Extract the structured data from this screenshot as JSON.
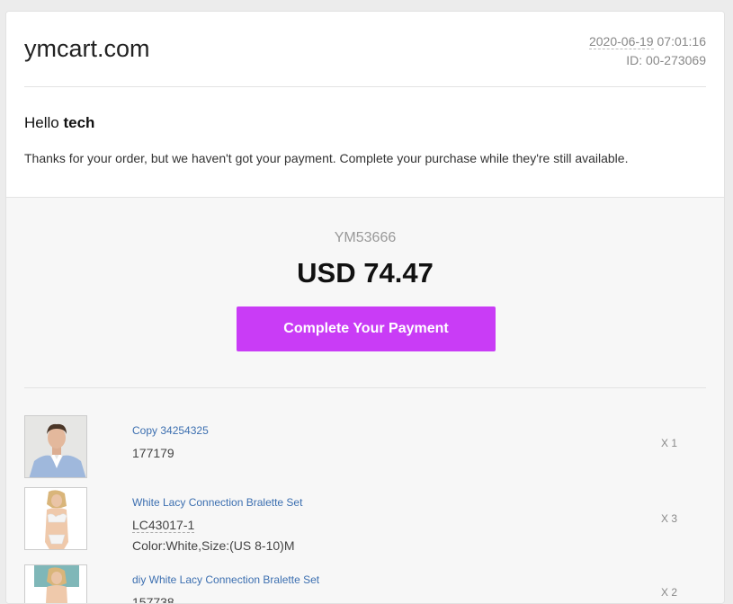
{
  "brand": "ymcart.com",
  "meta": {
    "date": "2020-06-19",
    "time": " 07:01:16",
    "id": "ID: 00-273069"
  },
  "greeting": {
    "hello": "Hello ",
    "name": "tech"
  },
  "message": "Thanks for your order, but we haven't got your payment. Complete your purchase while they're still available.",
  "order": {
    "number": "YM53666",
    "total": "USD 74.47",
    "pay_label": "Complete Your Payment"
  },
  "items": [
    {
      "name": "Copy 34254325",
      "sku": "177179",
      "attr": "",
      "qty": "X 1"
    },
    {
      "name": "White Lacy Connection Bralette Set",
      "sku": "LC43017-1",
      "attr": "Color:White,Size:(US 8-10)M",
      "qty": "X 3"
    },
    {
      "name": "diy White Lacy Connection Bralette Set",
      "sku": "157738",
      "attr": "",
      "qty": "X 2"
    }
  ],
  "colors": {
    "accent": "#c93cf6",
    "link": "#3c6fb0",
    "panel": "#f7f7f7"
  }
}
